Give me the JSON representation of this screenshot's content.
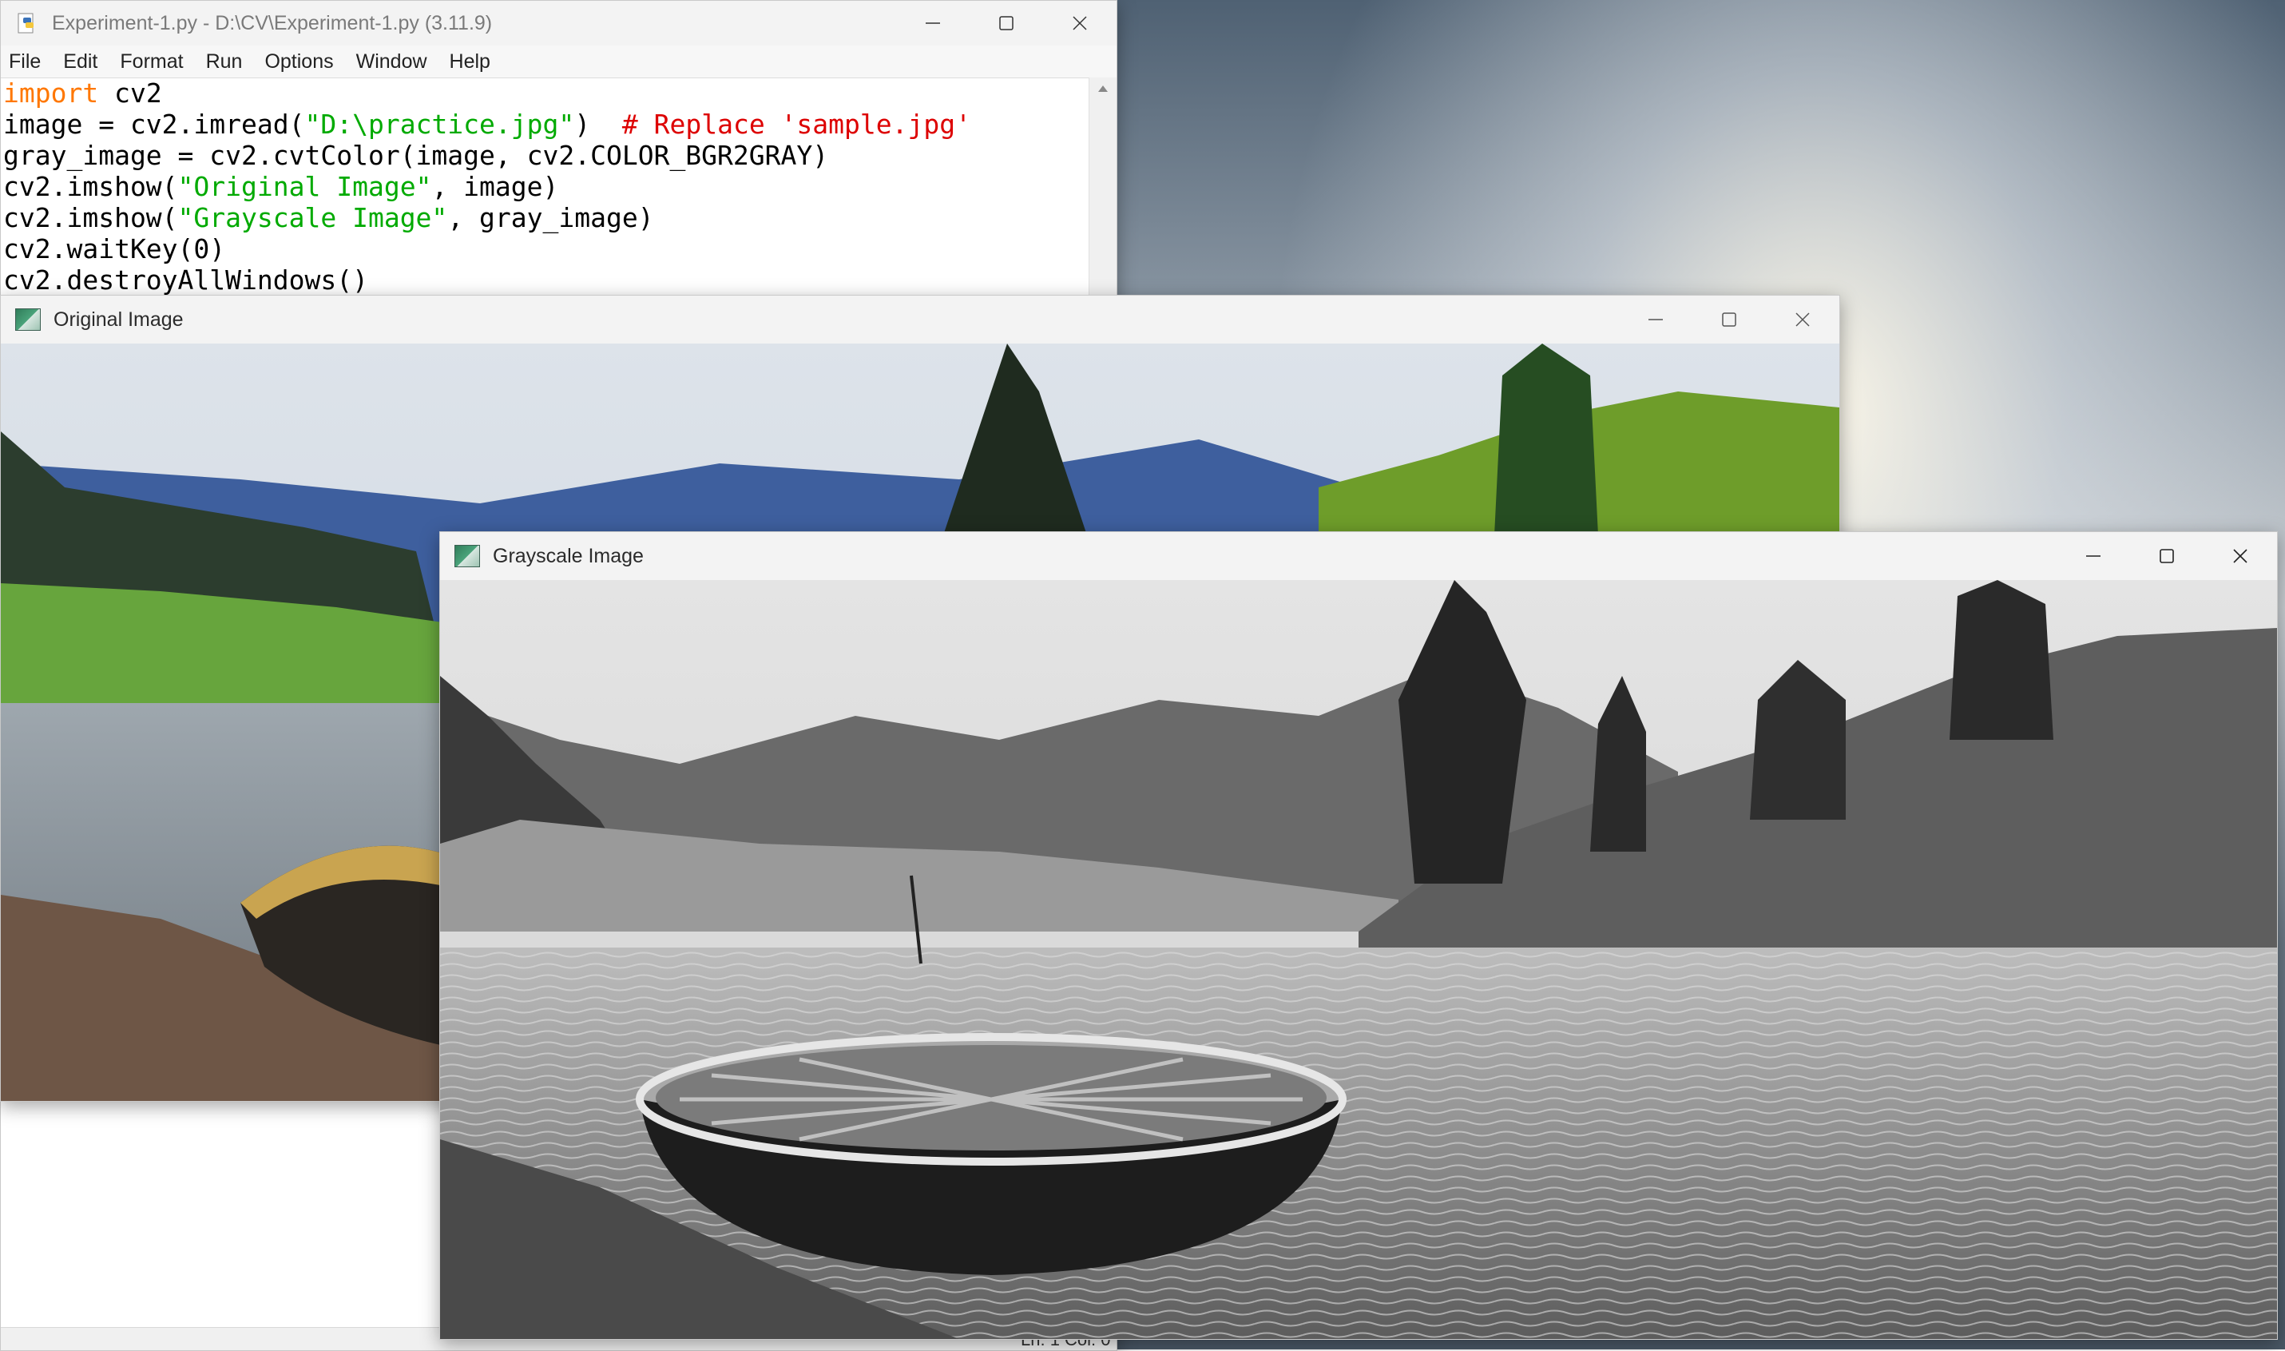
{
  "editor": {
    "title": "Experiment-1.py - D:\\CV\\Experiment-1.py (3.11.9)",
    "menu": [
      "File",
      "Edit",
      "Format",
      "Run",
      "Options",
      "Window",
      "Help"
    ],
    "code_lines": [
      [
        {
          "t": "import",
          "c": "kw"
        },
        {
          "t": " cv2",
          "c": ""
        }
      ],
      [
        {
          "t": "image = cv2.imread(",
          "c": ""
        },
        {
          "t": "\"D:\\practice.jpg\"",
          "c": "str"
        },
        {
          "t": ")  ",
          "c": ""
        },
        {
          "t": "# Replace 'sample.jpg'",
          "c": "com"
        }
      ],
      [
        {
          "t": "gray_image = cv2.cvtColor(image, cv2.COLOR_BGR2GRAY)",
          "c": ""
        }
      ],
      [
        {
          "t": "cv2.imshow(",
          "c": ""
        },
        {
          "t": "\"Original Image\"",
          "c": "str"
        },
        {
          "t": ", image)",
          "c": ""
        }
      ],
      [
        {
          "t": "cv2.imshow(",
          "c": ""
        },
        {
          "t": "\"Grayscale Image\"",
          "c": "str"
        },
        {
          "t": ", gray_image)",
          "c": ""
        }
      ],
      [
        {
          "t": "cv2.waitKey(0)",
          "c": ""
        }
      ],
      [
        {
          "t": "cv2.destroyAllWindows()",
          "c": ""
        }
      ]
    ],
    "status": "Ln: 1  Col: 0"
  },
  "original_window": {
    "title": "Original Image"
  },
  "grayscale_window": {
    "title": "Grayscale Image"
  },
  "icons": {
    "editor_app": "python-file-icon",
    "image_window": "opencv-window-icon",
    "minimize": "minimize-icon",
    "maximize": "maximize-icon",
    "close": "close-icon"
  },
  "colors": {
    "keyword": "#ff7700",
    "string": "#00aa00",
    "comment": "#dd0000"
  }
}
